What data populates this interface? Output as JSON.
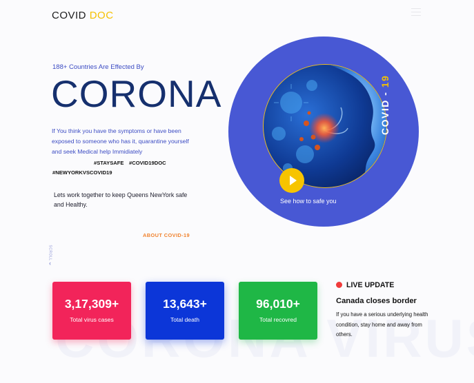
{
  "header": {
    "logo_main": "COVID",
    "logo_accent": "DOC",
    "menu_icon": "hamburger-icon"
  },
  "hero": {
    "subtitle": "188+ Countries Are Effected By",
    "headline": "CORONA",
    "body": "If You think you have the symptoms or have been exposed to  someone who has it, quarantine yourself and seek Medical help Immidiately",
    "tags": [
      "#STAYSAFE",
      "#COVID19DOC",
      "#NEWYORKVSCOVID19"
    ],
    "together": "Lets work together to keep Queens NewYork safe and Healthy.",
    "about_link": "ABOUT  COVID-19",
    "scroll_label": "SCROLL"
  },
  "media": {
    "vertical_label_main": "COVID - ",
    "vertical_label_accent": "19",
    "cta": "See how to safe you",
    "play_icon": "play-icon"
  },
  "stats": [
    {
      "value": "3,17,309+",
      "label": "Total virus cases",
      "color": "#f2245a"
    },
    {
      "value": "13,643+",
      "label": "Total death",
      "color": "#0c36d8"
    },
    {
      "value": "96,010+",
      "label": "Total recovred",
      "color": "#1fb746"
    }
  ],
  "live_update": {
    "heading": "LIVE UPDATE",
    "title": "Canada closes border",
    "body": "If you have a serious underlying health condition, stay home and away from others."
  },
  "watermark": "CORONA VIRUS",
  "colors": {
    "brand_blue": "#4858d4",
    "headline": "#16306e",
    "accent_yellow": "#f5c100",
    "accent_orange": "#f0822e"
  }
}
